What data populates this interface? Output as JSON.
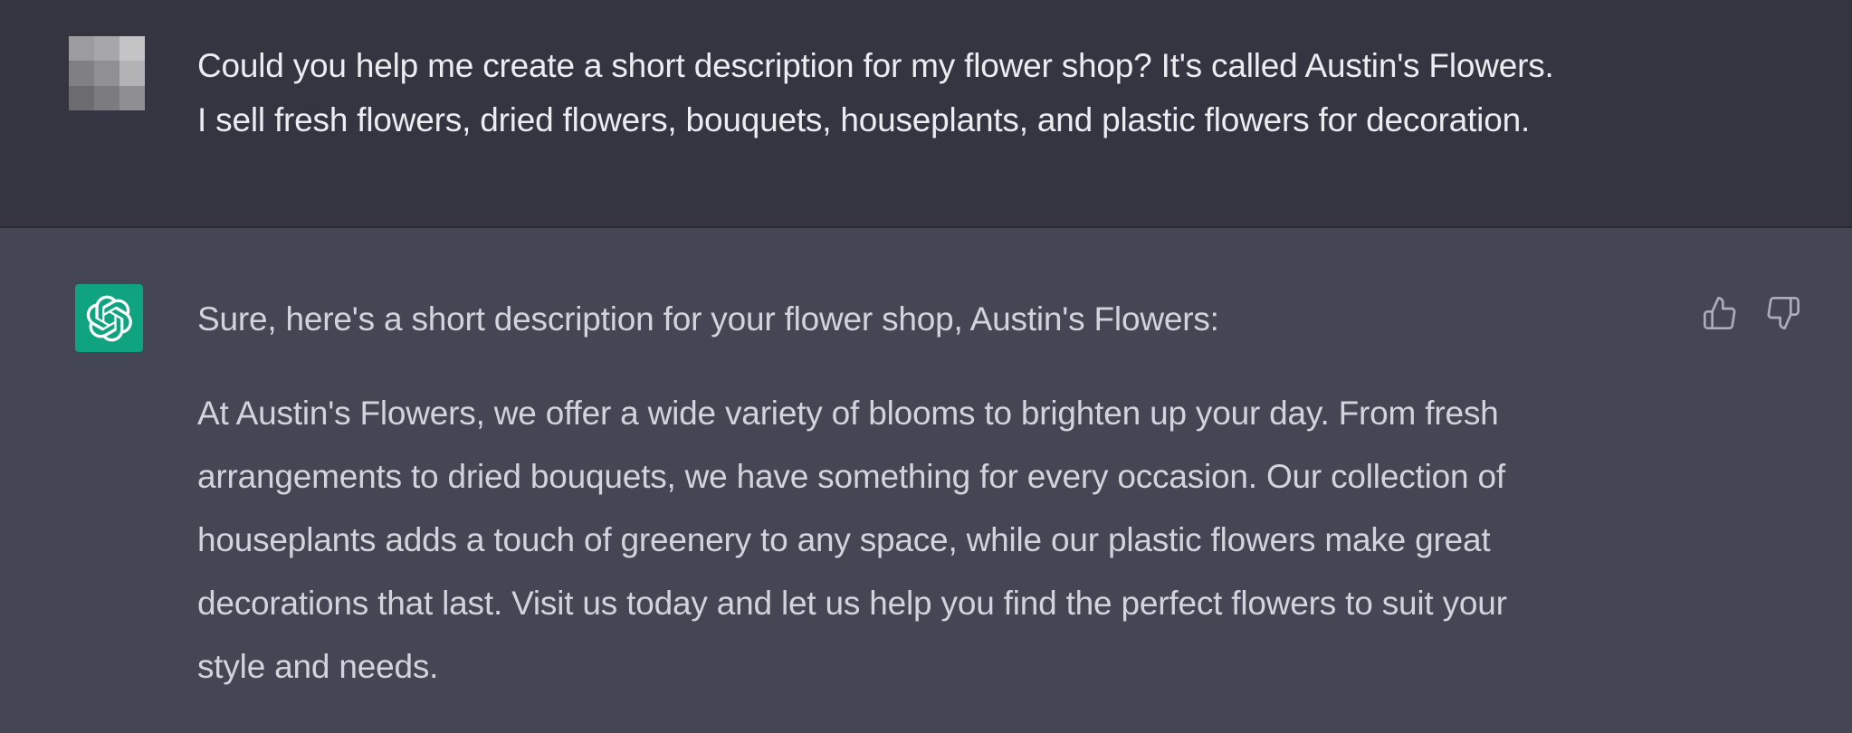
{
  "user_message": {
    "avatar_colors": [
      "#9b9ba0",
      "#a7a7ab",
      "#c4c4c6",
      "#7f7f84",
      "#909094",
      "#b3b3b6",
      "#6b6b70",
      "#7b7b80",
      "#8e8e93"
    ],
    "lines": [
      "Could you help me create a short description for my flower shop? It's called Austin's Flowers.",
      "I sell fresh flowers, dried flowers, bouquets, houseplants, and plastic flowers for decoration."
    ]
  },
  "assistant_message": {
    "avatar_icon": "openai-logo-icon",
    "avatar_color": "#10a37f",
    "intro": "Sure, here's a short description for your flower shop, Austin's Flowers:",
    "paragraph_lines": [
      "At Austin's Flowers, we offer a wide variety of blooms to brighten up your day. From fresh",
      "arrangements to dried bouquets, we have something for every occasion. Our collection of",
      "houseplants adds a touch of greenery to any space, while our plastic flowers make great",
      "decorations that last. Visit us today and let us help you find the perfect flowers to suit your",
      "style and needs."
    ],
    "feedback_icons": [
      "thumbs-up-icon",
      "thumbs-down-icon"
    ]
  },
  "colors": {
    "user_bg": "#343541",
    "assistant_bg": "#444654",
    "user_text": "#ececf1",
    "assistant_text": "#d1d5db",
    "icon_color": "#acacbe"
  }
}
